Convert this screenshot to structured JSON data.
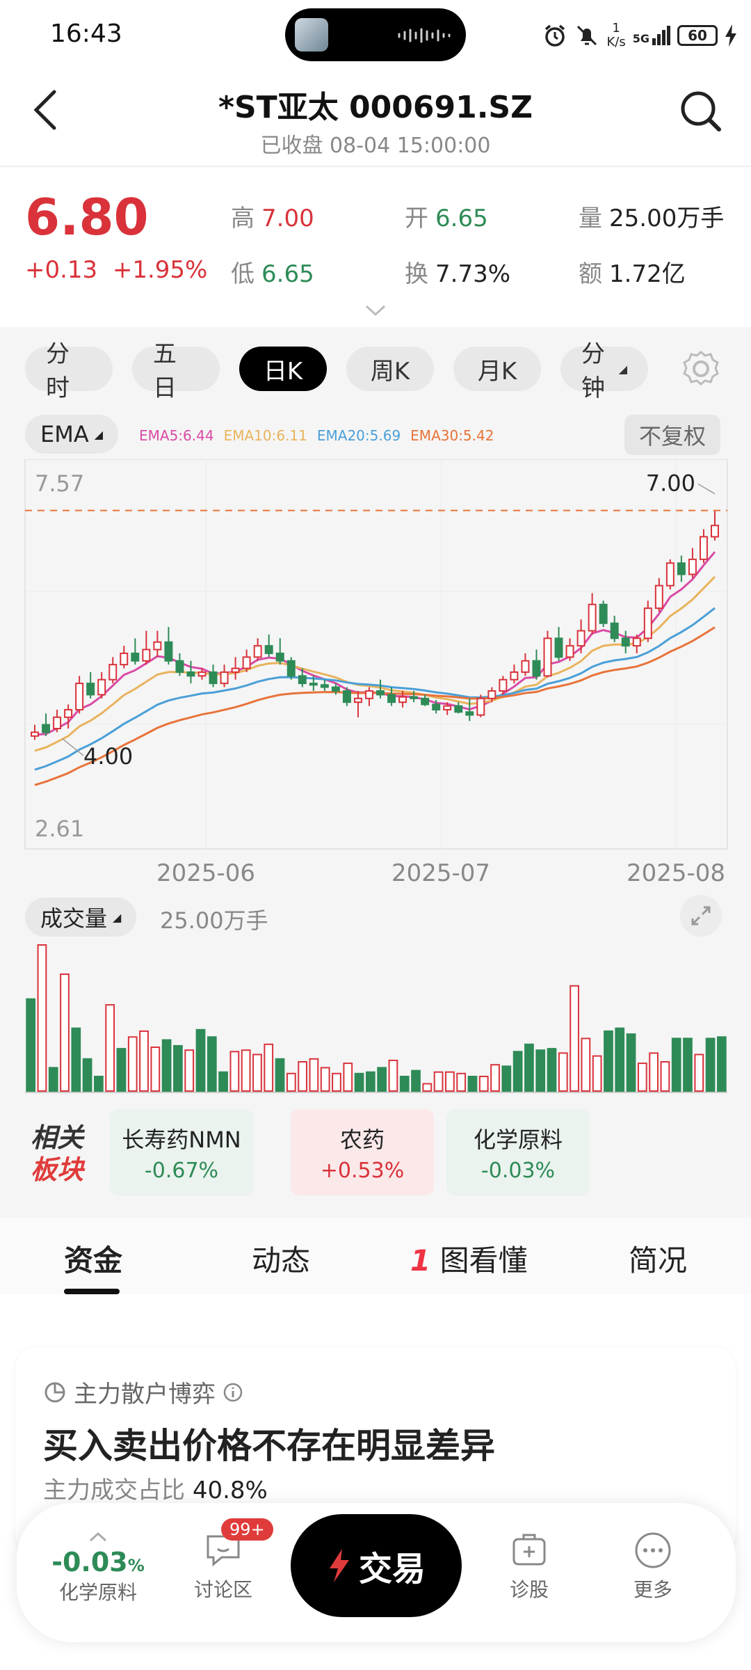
{
  "status": {
    "time": "16:43",
    "net_speed_top": "1",
    "net_speed_unit": "K/s",
    "signal": "5G",
    "battery": "60"
  },
  "header": {
    "title": "*ST亚太 000691.SZ",
    "subtitle": "已收盘 08-04 15:00:00"
  },
  "quote": {
    "price": "6.80",
    "change": "+0.13",
    "change_pct": "+1.95%",
    "high_label": "高",
    "high": "7.00",
    "low_label": "低",
    "low": "6.65",
    "open_label": "开",
    "open": "6.65",
    "turnover_label": "换",
    "turnover": "7.73%",
    "volume_label": "量",
    "volume": "25.00万手",
    "amount_label": "额",
    "amount": "1.72亿"
  },
  "period_tabs": [
    "分时",
    "五日",
    "日K",
    "周K",
    "月K",
    "分钟"
  ],
  "active_tab": "日K",
  "indicator": {
    "label": "EMA",
    "legend": [
      {
        "text": "EMA5:6.44",
        "color": "#d94aa6"
      },
      {
        "text": "EMA10:6.11",
        "color": "#e9b35d"
      },
      {
        "text": "EMA20:5.69",
        "color": "#4a9fd8"
      },
      {
        "text": "EMA30:5.42",
        "color": "#e8733a"
      }
    ],
    "adjust": "不复权"
  },
  "chart_data": {
    "type": "candlestick",
    "y_max_label": "7.57",
    "y_min_label": "2.61",
    "ylim": [
      2.61,
      7.57
    ],
    "high_marker": "7.00",
    "low_marker": "4.00",
    "x_ticks": [
      "2025-06",
      "2025-07",
      "2025-08"
    ],
    "candles": [
      [
        4.0,
        4.15,
        3.95,
        4.05
      ],
      [
        4.15,
        4.3,
        4.0,
        4.05
      ],
      [
        4.1,
        4.35,
        4.05,
        4.25
      ],
      [
        4.25,
        4.42,
        4.1,
        4.35
      ],
      [
        4.35,
        4.8,
        4.3,
        4.7
      ],
      [
        4.7,
        4.85,
        4.5,
        4.55
      ],
      [
        4.55,
        4.85,
        4.5,
        4.75
      ],
      [
        4.75,
        5.05,
        4.7,
        4.95
      ],
      [
        4.95,
        5.2,
        4.9,
        5.1
      ],
      [
        5.1,
        5.3,
        4.95,
        5.0
      ],
      [
        5.0,
        5.4,
        4.95,
        5.15
      ],
      [
        5.15,
        5.4,
        5.05,
        5.25
      ],
      [
        5.25,
        5.45,
        4.95,
        5.0
      ],
      [
        5.0,
        5.1,
        4.8,
        4.85
      ],
      [
        4.85,
        5.0,
        4.7,
        4.8
      ],
      [
        4.8,
        4.9,
        4.75,
        4.85
      ],
      [
        4.85,
        4.95,
        4.65,
        4.7
      ],
      [
        4.7,
        4.95,
        4.65,
        4.85
      ],
      [
        4.85,
        5.05,
        4.75,
        4.9
      ],
      [
        4.9,
        5.15,
        4.85,
        5.05
      ],
      [
        5.05,
        5.3,
        5.0,
        5.2
      ],
      [
        5.2,
        5.35,
        5.05,
        5.1
      ],
      [
        5.1,
        5.3,
        4.95,
        5.0
      ],
      [
        5.0,
        5.05,
        4.75,
        4.8
      ],
      [
        4.8,
        4.9,
        4.65,
        4.7
      ],
      [
        4.7,
        4.8,
        4.6,
        4.68
      ],
      [
        4.68,
        4.75,
        4.6,
        4.65
      ],
      [
        4.65,
        4.7,
        4.55,
        4.6
      ],
      [
        4.6,
        4.65,
        4.4,
        4.45
      ],
      [
        4.45,
        4.6,
        4.25,
        4.5
      ],
      [
        4.5,
        4.65,
        4.4,
        4.6
      ],
      [
        4.6,
        4.75,
        4.5,
        4.55
      ],
      [
        4.55,
        4.65,
        4.4,
        4.45
      ],
      [
        4.45,
        4.6,
        4.38,
        4.52
      ],
      [
        4.52,
        4.6,
        4.45,
        4.5
      ],
      [
        4.5,
        4.55,
        4.4,
        4.42
      ],
      [
        4.42,
        4.48,
        4.3,
        4.35
      ],
      [
        4.35,
        4.45,
        4.28,
        4.4
      ],
      [
        4.4,
        4.45,
        4.3,
        4.32
      ],
      [
        4.32,
        4.5,
        4.2,
        4.28
      ],
      [
        4.28,
        4.55,
        4.25,
        4.5
      ],
      [
        4.5,
        4.65,
        4.45,
        4.6
      ],
      [
        4.6,
        4.8,
        4.55,
        4.75
      ],
      [
        4.75,
        4.95,
        4.7,
        4.85
      ],
      [
        4.85,
        5.1,
        4.8,
        5.0
      ],
      [
        5.0,
        5.15,
        4.75,
        4.8
      ],
      [
        4.8,
        5.4,
        4.78,
        5.3
      ],
      [
        5.3,
        5.45,
        5.0,
        5.05
      ],
      [
        5.05,
        5.3,
        5.0,
        5.2
      ],
      [
        5.2,
        5.55,
        5.1,
        5.4
      ],
      [
        5.4,
        5.9,
        5.35,
        5.75
      ],
      [
        5.75,
        5.8,
        5.45,
        5.5
      ],
      [
        5.5,
        5.6,
        5.25,
        5.3
      ],
      [
        5.3,
        5.4,
        5.1,
        5.2
      ],
      [
        5.2,
        5.35,
        5.1,
        5.3
      ],
      [
        5.3,
        5.8,
        5.25,
        5.7
      ],
      [
        5.7,
        6.1,
        5.65,
        6.0
      ],
      [
        6.0,
        6.35,
        5.95,
        6.3
      ],
      [
        6.3,
        6.4,
        6.05,
        6.15
      ],
      [
        6.15,
        6.5,
        6.1,
        6.35
      ],
      [
        6.35,
        6.75,
        6.3,
        6.65
      ],
      [
        6.65,
        7.0,
        6.6,
        6.8
      ]
    ],
    "volumes": [
      [
        0.63,
        1
      ],
      [
        1,
        0
      ],
      [
        0.16,
        1
      ],
      [
        0.8,
        0
      ],
      [
        0.43,
        1
      ],
      [
        0.22,
        1
      ],
      [
        0.1,
        1
      ],
      [
        0.59,
        0
      ],
      [
        0.29,
        1
      ],
      [
        0.37,
        0
      ],
      [
        0.41,
        0
      ],
      [
        0.3,
        0
      ],
      [
        0.35,
        1
      ],
      [
        0.31,
        1
      ],
      [
        0.28,
        0
      ],
      [
        0.42,
        1
      ],
      [
        0.37,
        1
      ],
      [
        0.13,
        1
      ],
      [
        0.27,
        0
      ],
      [
        0.28,
        0
      ],
      [
        0.25,
        0
      ],
      [
        0.32,
        0
      ],
      [
        0.22,
        1
      ],
      [
        0.12,
        0
      ],
      [
        0.2,
        0
      ],
      [
        0.22,
        0
      ],
      [
        0.16,
        0
      ],
      [
        0.12,
        0
      ],
      [
        0.19,
        0
      ],
      [
        0.12,
        1
      ],
      [
        0.13,
        1
      ],
      [
        0.16,
        1
      ],
      [
        0.21,
        0
      ],
      [
        0.1,
        1
      ],
      [
        0.14,
        1
      ],
      [
        0.05,
        0
      ],
      [
        0.13,
        0
      ],
      [
        0.13,
        0
      ],
      [
        0.12,
        0
      ],
      [
        0.1,
        1
      ],
      [
        0.1,
        0
      ],
      [
        0.18,
        0
      ],
      [
        0.17,
        1
      ],
      [
        0.27,
        1
      ],
      [
        0.32,
        1
      ],
      [
        0.28,
        1
      ],
      [
        0.29,
        1
      ],
      [
        0.26,
        0
      ],
      [
        0.72,
        0
      ],
      [
        0.36,
        0
      ],
      [
        0.24,
        0
      ],
      [
        0.41,
        1
      ],
      [
        0.43,
        1
      ],
      [
        0.39,
        1
      ],
      [
        0.19,
        0
      ],
      [
        0.26,
        0
      ],
      [
        0.2,
        0
      ],
      [
        0.36,
        1
      ],
      [
        0.36,
        1
      ],
      [
        0.25,
        0
      ],
      [
        0.36,
        1
      ],
      [
        0.37,
        1
      ]
    ]
  },
  "volume": {
    "label": "成交量",
    "value": "25.00万手"
  },
  "related": {
    "label_top": "相关",
    "label_bottom": "板块",
    "sectors": [
      {
        "name": "长寿药NMN",
        "pct": "-0.67%"
      },
      {
        "name": "农药",
        "pct": "+0.53%"
      },
      {
        "name": "化学原料",
        "pct": "-0.03%"
      }
    ]
  },
  "content_tabs": [
    "资金",
    "动态",
    "图看懂",
    "简况"
  ],
  "card": {
    "tag": "主力散户博弈",
    "headline": "买入卖出价格不存在明显差异",
    "sub_label": "主力成交占比",
    "sub_value": "40.8%"
  },
  "bottom_bar": {
    "sector_pct": "-0.03",
    "sector_pct_unit": "%",
    "sector_name": "化学原料",
    "discussion": "讨论区",
    "badge": "99+",
    "trade": "交易",
    "diagnose": "诊股",
    "more": "更多"
  },
  "colors": {
    "up": "#d9323a",
    "down": "#2e8b57",
    "accent": "#000000"
  }
}
